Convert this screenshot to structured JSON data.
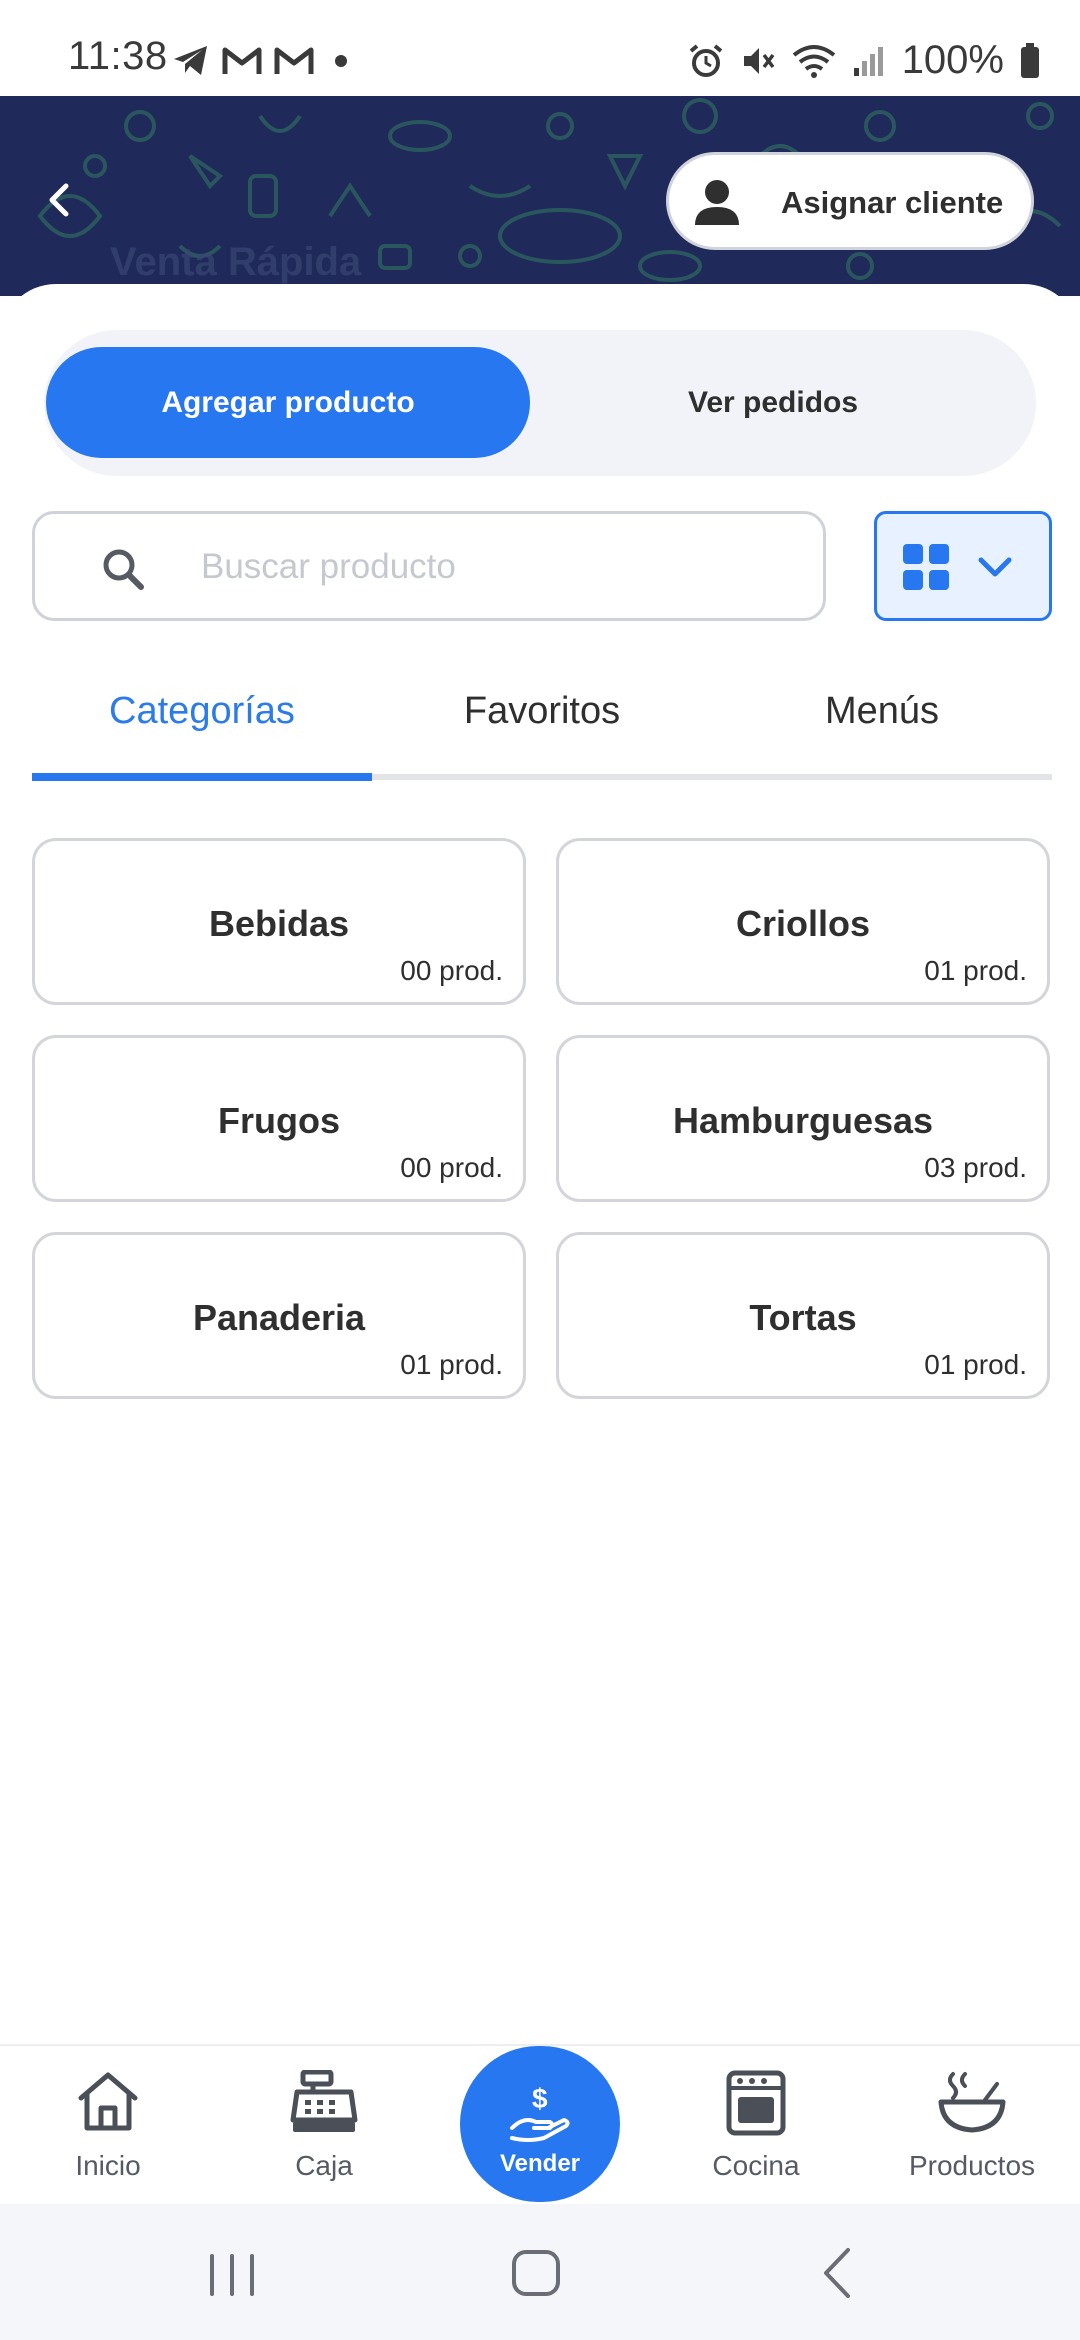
{
  "status_bar": {
    "time": "11:38",
    "battery_text": "100%",
    "left_icons": [
      "telegram-icon",
      "gmail-icon",
      "gmail-icon",
      "dot-icon"
    ],
    "right_icons": [
      "alarm-icon",
      "mute-icon",
      "wifi-icon",
      "signal-icon",
      "battery-icon"
    ]
  },
  "header": {
    "title": "Venta Rápida",
    "assign_client_label": "Asignar cliente",
    "bg_color": "#1f2a5a"
  },
  "segment": {
    "active_label": "Agregar producto",
    "inactive_label": "Ver pedidos",
    "accent": "#2777f0"
  },
  "search": {
    "placeholder": "Buscar producto",
    "value": ""
  },
  "tabs": {
    "categories": "Categorías",
    "favorites": "Favoritos",
    "menus": "Menús",
    "active": "Categorías"
  },
  "categories": [
    {
      "name": "Bebidas",
      "count": "00 prod."
    },
    {
      "name": "Criollos",
      "count": "01 prod."
    },
    {
      "name": "Frugos",
      "count": "00 prod."
    },
    {
      "name": "Hamburguesas",
      "count": "03 prod."
    },
    {
      "name": "Panaderia",
      "count": "01 prod."
    },
    {
      "name": "Tortas",
      "count": "01 prod."
    }
  ],
  "bottom_nav": {
    "inicio": "Inicio",
    "caja": "Caja",
    "vender": "Vender",
    "cocina": "Cocina",
    "productos": "Productos"
  }
}
